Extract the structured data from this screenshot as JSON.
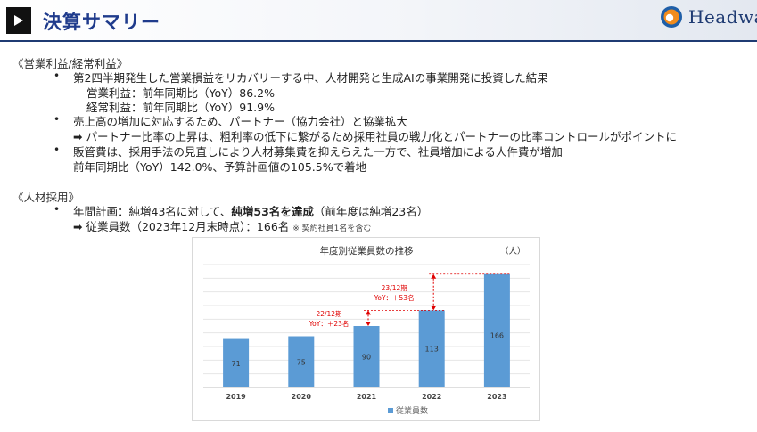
{
  "header": {
    "title": "決算サマリー",
    "logo_text": "Headwa",
    "accent": "#1f3b8c"
  },
  "profit_section": {
    "heading": "《営業利益/経常利益》",
    "bullets": [
      {
        "text": "第2四半期発生した営業損益をリカバリーする中、人材開発と生成AIの事業開発に投資した結果",
        "sublines": [
          "営業利益：前年同期比（YoY）86.2%",
          "経常利益：前年同期比（YoY）91.9%"
        ]
      },
      {
        "text": "売上高の増加に対応するため、パートナー（協力会社）と協業拡大",
        "sublines": [
          "➡ パートナー比率の上昇は、粗利率の低下に繋がるため採用社員の戦力化とパートナーの比率コントロールがポイントに"
        ]
      },
      {
        "text": "販管費は、採用手法の見直しにより人材募集費を抑えらえた一方で、社員増加による人件費が増加",
        "sublines": [
          "前年同期比（YoY）142.0%、予算計画値の105.5%で着地"
        ]
      }
    ]
  },
  "hiring_section": {
    "heading": "《人材採用》",
    "bullet_prefix": "年間計画：純増43名に対して、",
    "bullet_bold": "純増53名を達成",
    "bullet_suffix": "（前年度は純増23名）",
    "subline_main": "➡ 従業員数（2023年12月末時点）：166名",
    "subline_note": "※ 契約社員1名を含む"
  },
  "chart_data": {
    "type": "bar",
    "title": "年度別従業員数の推移",
    "unit": "（人）",
    "categories": [
      "2019",
      "2020",
      "2021",
      "2022",
      "2023"
    ],
    "series": [
      {
        "name": "従業員数",
        "values": [
          71,
          75,
          90,
          113,
          166
        ]
      }
    ],
    "ylim": [
      0,
      180
    ],
    "grid": true,
    "legend": "bottom",
    "bar_color": "#5b9bd5",
    "annotations": [
      {
        "label_1": "22/12期",
        "label_2": "YoY：＋23名",
        "from": "2021",
        "to": "2022"
      },
      {
        "label_1": "23/12期",
        "label_2": "YoY：＋53名",
        "from": "2022",
        "to": "2023"
      }
    ],
    "annotation_color": "#e00000"
  }
}
